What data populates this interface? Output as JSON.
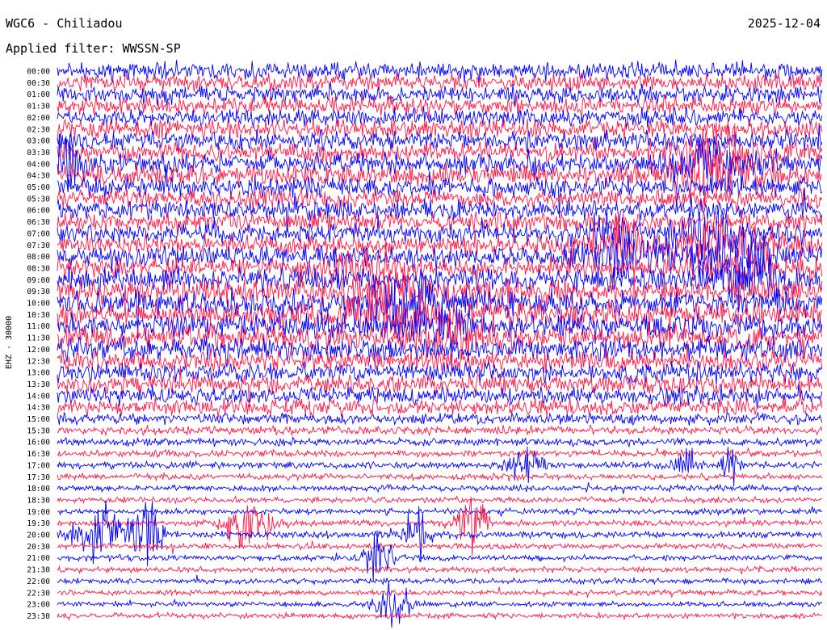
{
  "header": {
    "station_title": "WGC6 - Chiliadou",
    "date": "2025-12-04",
    "filter_text": "Applied filter: WWSSN-SP"
  },
  "chart_data": {
    "type": "line",
    "title": "WGC6 - Chiliadou",
    "subtitle": "Applied filter: WWSSN-SP",
    "ylabel": "EHZ - 30000",
    "date": "2025-12-04",
    "row_labels": [
      "00:00",
      "00:30",
      "01:00",
      "01:30",
      "02:00",
      "02:30",
      "03:00",
      "03:30",
      "04:00",
      "04:30",
      "05:00",
      "05:30",
      "06:00",
      "06:30",
      "07:00",
      "07:30",
      "08:00",
      "08:30",
      "09:00",
      "09:30",
      "10:00",
      "10:30",
      "11:00",
      "11:30",
      "12:00",
      "12:30",
      "13:00",
      "13:30",
      "14:00",
      "14:30",
      "15:00",
      "15:30",
      "16:00",
      "16:30",
      "17:00",
      "17:30",
      "18:00",
      "18:30",
      "19:00",
      "19:30",
      "20:00",
      "20:30",
      "21:00",
      "21:30",
      "22:00",
      "22:30",
      "23:00",
      "23:30"
    ],
    "trace_colors": [
      "#0000ff",
      "#ff1744"
    ],
    "row_amplitude": [
      0.9,
      0.9,
      0.9,
      0.9,
      0.9,
      0.95,
      1.0,
      1.0,
      1.05,
      1.05,
      1.0,
      1.0,
      1.0,
      1.0,
      1.0,
      1.05,
      1.1,
      1.15,
      1.2,
      1.25,
      1.3,
      1.3,
      1.3,
      1.25,
      1.2,
      1.1,
      1.0,
      0.95,
      0.9,
      0.85,
      0.55,
      0.45,
      0.4,
      0.35,
      0.35,
      0.32,
      0.32,
      0.3,
      0.3,
      0.32,
      0.35,
      0.3,
      0.3,
      0.3,
      0.28,
      0.28,
      0.28,
      0.28
    ],
    "events": [
      {
        "row": 7,
        "t": 0.86,
        "amp": 2.2,
        "width": 0.05
      },
      {
        "row": 8,
        "t": 0.01,
        "amp": 1.8,
        "width": 0.02
      },
      {
        "row": 8,
        "t": 0.86,
        "amp": 2.0,
        "width": 0.06
      },
      {
        "row": 9,
        "t": 0.85,
        "amp": 2.0,
        "width": 0.06
      },
      {
        "row": 14,
        "t": 0.85,
        "amp": 1.8,
        "width": 0.04
      },
      {
        "row": 14,
        "t": 0.72,
        "amp": 1.4,
        "width": 0.03
      },
      {
        "row": 15,
        "t": 0.87,
        "amp": 2.2,
        "width": 0.06
      },
      {
        "row": 15,
        "t": 0.74,
        "amp": 1.6,
        "width": 0.04
      },
      {
        "row": 16,
        "t": 0.75,
        "amp": 1.8,
        "width": 0.06
      },
      {
        "row": 16,
        "t": 0.89,
        "amp": 2.0,
        "width": 0.05
      },
      {
        "row": 17,
        "t": 0.39,
        "amp": 1.6,
        "width": 0.04
      },
      {
        "row": 17,
        "t": 0.9,
        "amp": 1.8,
        "width": 0.04
      },
      {
        "row": 18,
        "t": 0.9,
        "amp": 2.0,
        "width": 0.05
      },
      {
        "row": 19,
        "t": 0.43,
        "amp": 1.6,
        "width": 0.05
      },
      {
        "row": 20,
        "t": 0.45,
        "amp": 2.0,
        "width": 0.06
      },
      {
        "row": 21,
        "t": 0.44,
        "amp": 1.8,
        "width": 0.06
      },
      {
        "row": 22,
        "t": 0.49,
        "amp": 1.5,
        "width": 0.05
      },
      {
        "row": 23,
        "t": 0.52,
        "amp": 1.4,
        "width": 0.05
      },
      {
        "row": 34,
        "t": 0.61,
        "amp": 2.5,
        "width": 0.02
      },
      {
        "row": 34,
        "t": 0.82,
        "amp": 2.2,
        "width": 0.015
      },
      {
        "row": 34,
        "t": 0.88,
        "amp": 4.0,
        "width": 0.008
      },
      {
        "row": 39,
        "t": 0.25,
        "amp": 3.0,
        "width": 0.03
      },
      {
        "row": 39,
        "t": 0.54,
        "amp": 3.5,
        "width": 0.02
      },
      {
        "row": 40,
        "t": 0.06,
        "amp": 3.2,
        "width": 0.04
      },
      {
        "row": 40,
        "t": 0.12,
        "amp": 2.5,
        "width": 0.02
      },
      {
        "row": 40,
        "t": 0.47,
        "amp": 2.5,
        "width": 0.015
      },
      {
        "row": 42,
        "t": 0.42,
        "amp": 2.5,
        "width": 0.02
      },
      {
        "row": 46,
        "t": 0.44,
        "amp": 2.5,
        "width": 0.02
      }
    ]
  }
}
